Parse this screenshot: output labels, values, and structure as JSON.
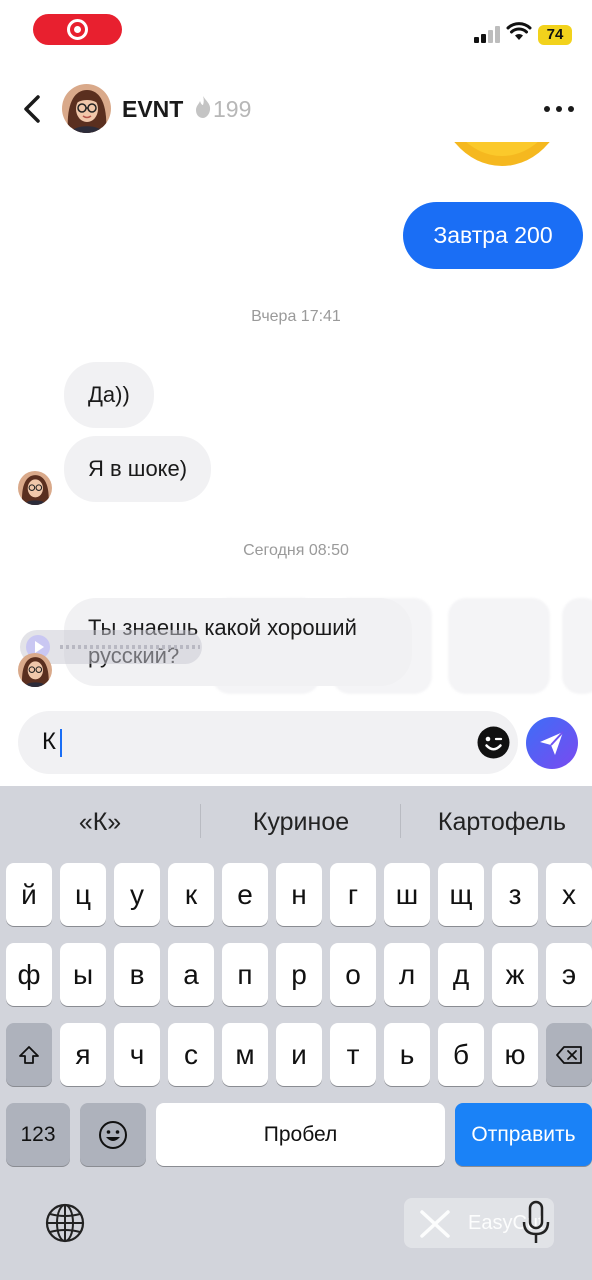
{
  "status_bar": {
    "battery": "74",
    "accent": "#e8202f",
    "battery_color": "#f2d21c"
  },
  "header": {
    "contact_name": "EVNT",
    "streak_count": "199",
    "icons": [
      "back-arrow-icon",
      "fire-icon",
      "more-dots-icon"
    ]
  },
  "messages": {
    "outgoing_1": "Завтра 200",
    "timestamp_1": "Вчера 17:41",
    "incoming_1": "Да))",
    "incoming_2": "Я в шоке)",
    "timestamp_2": "Сегодня 08:50",
    "incoming_3": "Ты знаешь какой хороший русский?"
  },
  "composer": {
    "value": "К",
    "accent": "#1a6ef5",
    "icons": [
      "emoji-icon",
      "send-icon"
    ]
  },
  "keyboard": {
    "suggestions": [
      "«К»",
      "Куриное",
      "Картофель"
    ],
    "row1": [
      "й",
      "ц",
      "у",
      "к",
      "е",
      "н",
      "г",
      "ш",
      "щ",
      "з",
      "х"
    ],
    "row2": [
      "ф",
      "ы",
      "в",
      "а",
      "п",
      "р",
      "о",
      "л",
      "д",
      "ж",
      "э"
    ],
    "row3": [
      "я",
      "ч",
      "с",
      "м",
      "и",
      "т",
      "ь",
      "б",
      "ю"
    ],
    "numbers_key": "123",
    "space_key": "Пробел",
    "send_key": "Отправить",
    "icons": [
      "shift-icon",
      "backspace-icon",
      "emoji-key-icon",
      "globe-icon",
      "microphone-icon"
    ]
  },
  "watermark": {
    "label": "EasyCut"
  }
}
